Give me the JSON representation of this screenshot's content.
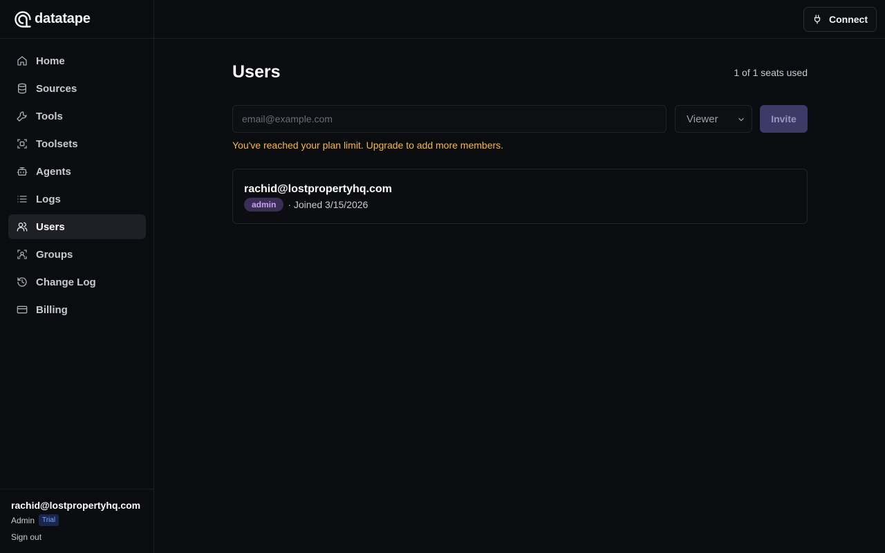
{
  "brand": {
    "name": "datatape"
  },
  "topbar": {
    "connect_label": "Connect"
  },
  "sidebar": {
    "items": [
      {
        "label": "Home",
        "icon": "home-icon",
        "active": false
      },
      {
        "label": "Sources",
        "icon": "database-icon",
        "active": false
      },
      {
        "label": "Tools",
        "icon": "wrench-icon",
        "active": false
      },
      {
        "label": "Toolsets",
        "icon": "scan-icon",
        "active": false
      },
      {
        "label": "Agents",
        "icon": "bot-icon",
        "active": false
      },
      {
        "label": "Logs",
        "icon": "list-icon",
        "active": false
      },
      {
        "label": "Users",
        "icon": "users-icon",
        "active": true
      },
      {
        "label": "Groups",
        "icon": "scan-user-icon",
        "active": false
      },
      {
        "label": "Change Log",
        "icon": "history-icon",
        "active": false
      },
      {
        "label": "Billing",
        "icon": "credit-card-icon",
        "active": false
      }
    ],
    "footer": {
      "email": "rachid@lostpropertyhq.com",
      "role": "Admin",
      "plan_badge": "Trial",
      "sign_out": "Sign out"
    }
  },
  "main": {
    "title": "Users",
    "seats": "1 of 1 seats used",
    "invite": {
      "email_placeholder": "email@example.com",
      "email_value": "",
      "role_value": "Viewer",
      "button_label": "Invite"
    },
    "limit_message": "You've reached your plan limit. Upgrade to add more members.",
    "users": [
      {
        "email": "rachid@lostpropertyhq.com",
        "role": "admin",
        "joined": "· Joined 3/15/2026"
      }
    ]
  },
  "colors": {
    "background": "#0b0c10",
    "warning": "#f5b940",
    "accent": "#3e3a68",
    "role_badge": "#c3a2f5",
    "trial_badge": "#7fa7ff"
  }
}
